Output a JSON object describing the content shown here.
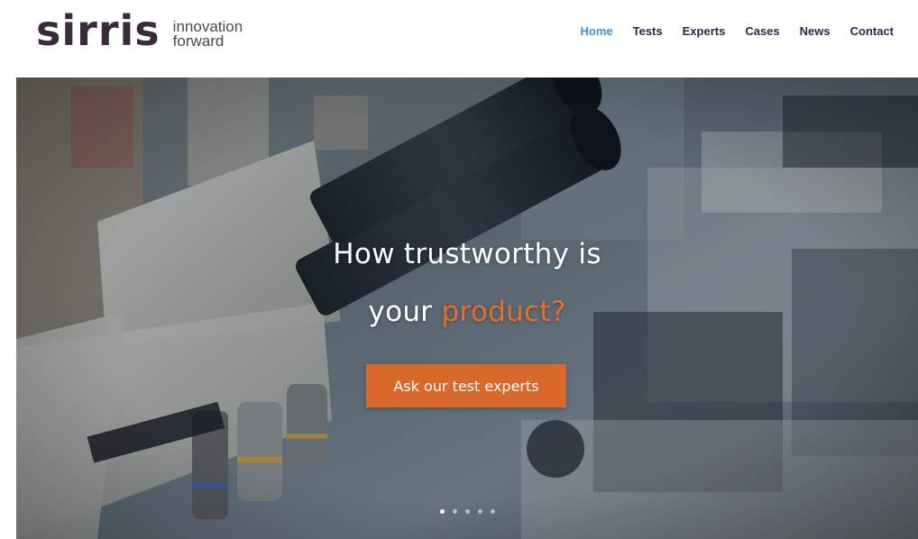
{
  "brand": {
    "name": "sirris",
    "tagline_line1": "innovation",
    "tagline_line2": "forward",
    "color": "#3a2a3c"
  },
  "nav": {
    "items": [
      {
        "label": "Home",
        "active": true
      },
      {
        "label": "Tests",
        "active": false
      },
      {
        "label": "Experts",
        "active": false
      },
      {
        "label": "Cases",
        "active": false
      },
      {
        "label": "News",
        "active": false
      },
      {
        "label": "Contact",
        "active": false
      }
    ],
    "active_color": "#3a8fd6",
    "color": "#1f2b4a"
  },
  "hero": {
    "headline_line1": "How trustworthy is",
    "headline_line2_prefix": "your ",
    "headline_line2_accent": "product?",
    "accent_color": "#e8702a",
    "cta_label": "Ask our test experts",
    "cta_color": "#d9692a",
    "background_image": "microscope-photo",
    "slides": 5,
    "active_slide": 1
  }
}
